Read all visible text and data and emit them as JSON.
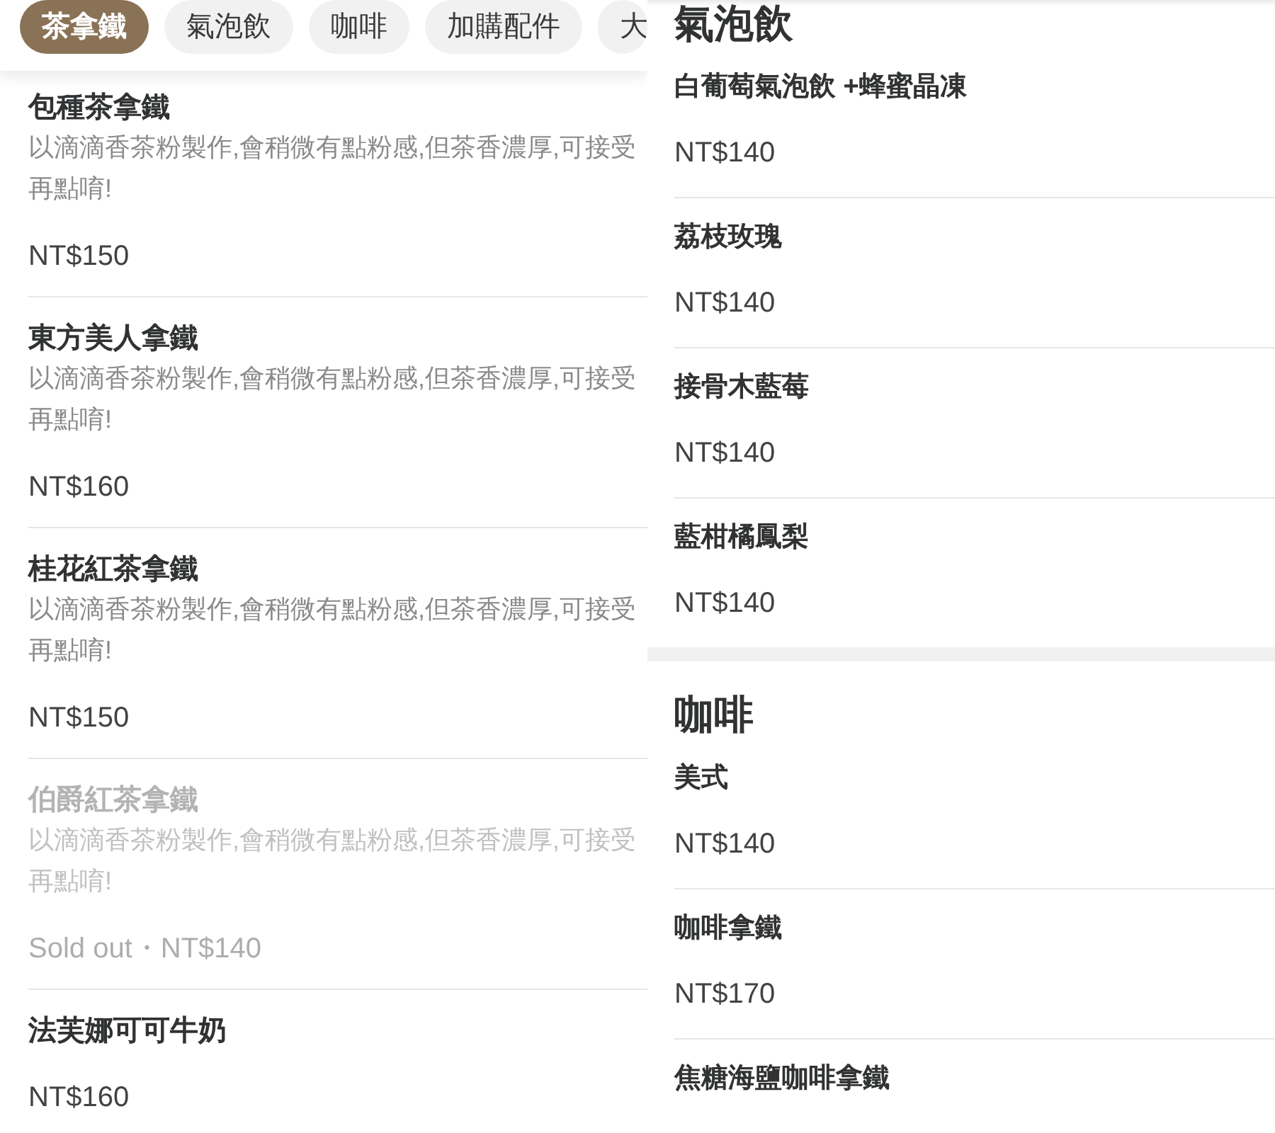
{
  "left_panel": {
    "tabs": [
      {
        "label": "茶拿鐵",
        "selected": true
      },
      {
        "label": "氣泡飲",
        "selected": false
      },
      {
        "label": "咖啡",
        "selected": false
      },
      {
        "label": "加購配件",
        "selected": false
      },
      {
        "label": "大",
        "selected": false
      }
    ],
    "items": [
      {
        "name": "包種茶拿鐵",
        "description": "以滴滴香茶粉製作,會稍微有點粉感,但茶香濃厚,可接受再點唷!",
        "price": "NT$150",
        "sold_out": false
      },
      {
        "name": "東方美人拿鐵",
        "description": "以滴滴香茶粉製作,會稍微有點粉感,但茶香濃厚,可接受再點唷!",
        "price": "NT$160",
        "sold_out": false
      },
      {
        "name": "桂花紅茶拿鐵",
        "description": "以滴滴香茶粉製作,會稍微有點粉感,但茶香濃厚,可接受再點唷!",
        "price": "NT$150",
        "sold_out": false
      },
      {
        "name": "伯爵紅茶拿鐵",
        "description": "以滴滴香茶粉製作,會稍微有點粉感,但茶香濃厚,可接受再點唷!",
        "price": "Sold out・NT$140",
        "sold_out": true
      },
      {
        "name": "法芙娜可可牛奶",
        "price": "NT$160",
        "sold_out": false
      }
    ]
  },
  "right_panel": {
    "sections": [
      {
        "title": "氣泡飲",
        "items": [
          {
            "name": "白葡萄氣泡飲 +蜂蜜晶凍",
            "price": "NT$140"
          },
          {
            "name": "荔枝玫瑰",
            "price": "NT$140"
          },
          {
            "name": "接骨木藍莓",
            "price": "NT$140"
          },
          {
            "name": "藍柑橘鳳梨",
            "price": "NT$140"
          }
        ]
      },
      {
        "title": "咖啡",
        "items": [
          {
            "name": "美式",
            "price": "NT$140"
          },
          {
            "name": "咖啡拿鐵",
            "price": "NT$170"
          },
          {
            "name": "焦糖海鹽咖啡拿鐵"
          }
        ]
      }
    ]
  }
}
